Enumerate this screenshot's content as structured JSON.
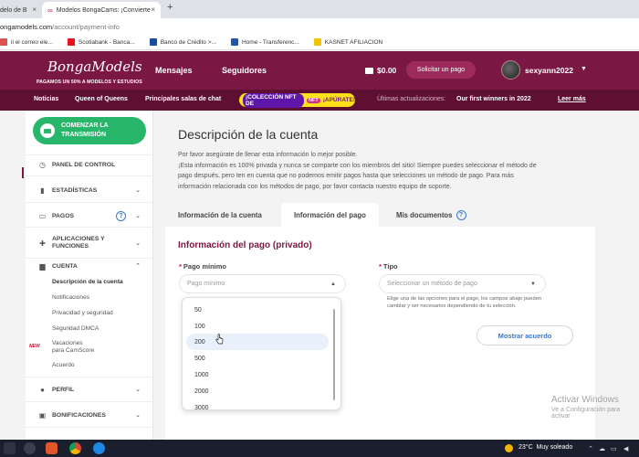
{
  "browser": {
    "tabs": [
      {
        "label": "delo de B",
        "close": "×"
      },
      {
        "label": "Modelos BongaCams: ¡Convierte",
        "close": "×"
      }
    ],
    "new_tab": "+",
    "url_host": "ongamodels.com",
    "url_path": "/account/payment-info",
    "bookmarks": [
      {
        "label": "il el correo ele...",
        "color": "#d9534f"
      },
      {
        "label": "Scotiabank - Banca...",
        "color": "#ec111a"
      },
      {
        "label": "Banco de Crédito >...",
        "color": "#1b4b9b"
      },
      {
        "label": "Home - Transferenc...",
        "color": "#2255aa"
      },
      {
        "label": "KASNET AFILIACION",
        "color": "#f2c200"
      }
    ]
  },
  "header": {
    "logo": "BongaModels",
    "tagline": "PAGAMOS UN 50% A MODELOS Y ESTUDIOS",
    "nav": [
      "Mensajes",
      "Seguidores"
    ],
    "balance": "$0.00",
    "request_payment": "Solicitar un pago",
    "username": "sexyann2022"
  },
  "subnav": {
    "items": [
      "Noticias",
      "Queen of Queens",
      "Principales salas de chat"
    ],
    "nft_label": "¡COLECCIÓN NFT DE",
    "nft_pill": "NFT",
    "nft_cta": "¡APÚRATE!",
    "updates_label": "Últimas actualizaciones:",
    "updates_value": "Our first winners in 2022",
    "read_more": "Leer más"
  },
  "sidebar": {
    "stream_line1": "COMENZAR LA",
    "stream_line2": "TRANSMISIÓN",
    "items": [
      {
        "label": "PANEL DE CONTROL",
        "icon": "clock-icon"
      },
      {
        "label": "ESTADÍSTICAS",
        "icon": "bar-chart-icon"
      },
      {
        "label": "PAGOS",
        "icon": "wallet-icon"
      },
      {
        "label": "APLICACIONES Y",
        "label2": "FUNCIONES",
        "icon": "puzzle-icon"
      },
      {
        "label": "CUENTA",
        "icon": "briefcase-icon"
      },
      {
        "label": "PERFIL",
        "icon": "person-icon"
      },
      {
        "label": "BONIFICACIONES",
        "icon": "gift-icon"
      }
    ],
    "help": "?",
    "sub_items": [
      "Descripción de la cuenta",
      "Notificaciones",
      "Privacidad y seguridad",
      "Seguridad DMCA",
      "Vacaciones",
      "para CamScore",
      "Acuerdo"
    ],
    "new_badge": "NEW"
  },
  "main": {
    "title": "Descripción de la cuenta",
    "desc_lines": [
      "Por favor asegúrate de llenar esta información lo mejor posible.",
      "¡Esta información es 100% privada y nunca se comparte con los miembros del sitio! Siempre puedes seleccionar el método de",
      "pago después, pero ten en cuenta que no podemos emitir pagos hasta que selecciones un método de pago. Para más",
      "información relacionada con los métodos de pago, por favor contacta nuestro equipo de soporte."
    ],
    "tabs": [
      "Información de la cuenta",
      "Información del pago",
      "Mis documentos"
    ],
    "panel_title": "Información del pago (privado)",
    "min_label": "Pago mínimo",
    "min_placeholder": "Pago mínimo",
    "type_label": "Tipo",
    "type_placeholder": "Seleccionar un método de pago",
    "hint": "Elige una de las opciones para el pago, los campos abajo pueden cambiar y ser necesarios dependiendo de tu selección.",
    "show_agreement": "Mostrar acuerdo",
    "required_mark": "*"
  },
  "dropdown": {
    "options": [
      "50",
      "100",
      "200",
      "500",
      "1000",
      "2000",
      "3000"
    ],
    "hovered": "200"
  },
  "watermark": {
    "line1": "Activar Windows",
    "line2": "Ve a Configuración para activar"
  },
  "taskbar": {
    "temp": "23°C",
    "weather": "Muy soleado"
  }
}
